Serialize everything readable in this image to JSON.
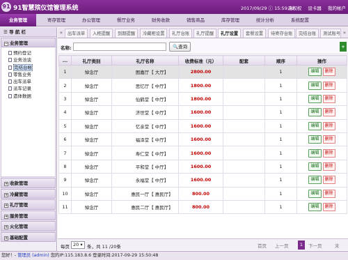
{
  "app": {
    "logo_text": "91",
    "title": "91智慧殡仪馆管理系统",
    "datetime": "2017/09/29 ⓘ 15:59:30",
    "top_links": [
      "高权权",
      "设卡器",
      "我的帐户"
    ]
  },
  "main_nav": [
    {
      "label": "业务管理",
      "active": true
    },
    {
      "label": "寄存管理",
      "active": false
    },
    {
      "label": "办公管理",
      "active": false
    },
    {
      "label": "餐厅业务",
      "active": false
    },
    {
      "label": "财务收款",
      "active": false
    },
    {
      "label": "销售商品",
      "active": false
    },
    {
      "label": "库存管理",
      "active": false
    },
    {
      "label": "统计分析",
      "active": false
    },
    {
      "label": "系统配置",
      "active": false
    }
  ],
  "sidebar": {
    "toolbar_label": "导 航 栏",
    "section_title": "业务管理",
    "items": [
      {
        "label": "预约登记",
        "selected": false
      },
      {
        "label": "业务洽谈",
        "selected": false
      },
      {
        "label": "完结台帐",
        "selected": true
      },
      {
        "label": "零售业务",
        "selected": false
      },
      {
        "label": "出车派单",
        "selected": false
      },
      {
        "label": "派车记录",
        "selected": false
      },
      {
        "label": "遗体数据",
        "selected": false
      }
    ],
    "collapsed_sections": [
      "收款管理",
      "冷藏管理",
      "礼厅管理",
      "服务管理",
      "火化管理",
      "基础配置"
    ]
  },
  "tabs": [
    {
      "label": "出车派单",
      "active": false
    },
    {
      "label": "入柜提醒",
      "active": false
    },
    {
      "label": "到期提醒",
      "active": false
    },
    {
      "label": "冷藏柜设置",
      "active": false
    },
    {
      "label": "礼厅台账",
      "active": false
    },
    {
      "label": "礼厅提醒",
      "active": false
    },
    {
      "label": "礼厅设置",
      "active": true
    },
    {
      "label": "套餐设置",
      "active": false
    },
    {
      "label": "待寄存台账",
      "active": false
    },
    {
      "label": "完结台账",
      "active": false
    },
    {
      "label": "测试账号一档案",
      "active": false
    }
  ],
  "search": {
    "label": "名称:",
    "value": "",
    "query_label": "查询",
    "add_label": "+"
  },
  "table": {
    "headers": [
      "...",
      "礼厅类别",
      "礼厅名称",
      "收费标准（元）",
      "配套",
      "顺序",
      "操作"
    ],
    "edit_label": "编辑",
    "delete_label": "删除",
    "rows": [
      {
        "no": "1",
        "category": "悼念厅",
        "name": "图嘉厅【 大厅】",
        "price": "2800.00",
        "kit": "",
        "order": "1",
        "selected": true
      },
      {
        "no": "2",
        "category": "悼念厅",
        "name": "思忆厅【 中厅】",
        "price": "1800.00",
        "kit": "",
        "order": "1",
        "selected": false
      },
      {
        "no": "3",
        "category": "悼念厅",
        "name": "仙鹤堂【 中厅】",
        "price": "1800.00",
        "kit": "",
        "order": "1",
        "selected": false
      },
      {
        "no": "4",
        "category": "悼念厅",
        "name": "济世堂【 中厅】",
        "price": "1600.00",
        "kit": "",
        "order": "1",
        "selected": false
      },
      {
        "no": "5",
        "category": "悼念厅",
        "name": "忆亲堂【 中厅】",
        "price": "1600.00",
        "kit": "",
        "order": "1",
        "selected": false
      },
      {
        "no": "6",
        "category": "悼念厅",
        "name": "福泽堂【 中厅】",
        "price": "1600.00",
        "kit": "",
        "order": "1",
        "selected": false
      },
      {
        "no": "7",
        "category": "悼念厅",
        "name": "寿仁堂【 中厅】",
        "price": "1600.00",
        "kit": "",
        "order": "1",
        "selected": false
      },
      {
        "no": "8",
        "category": "悼念厅",
        "name": "平和堂【 中厅】",
        "price": "1600.00",
        "kit": "",
        "order": "1",
        "selected": false
      },
      {
        "no": "9",
        "category": "悼念厅",
        "name": "永福堂【 中厅】",
        "price": "1600.00",
        "kit": "",
        "order": "1",
        "selected": false
      },
      {
        "no": "10",
        "category": "悼念厅",
        "name": "惠民一厅【 惠民厅】",
        "price": "800.00",
        "kit": "",
        "order": "1",
        "selected": false
      },
      {
        "no": "11",
        "category": "悼念厅",
        "name": "惠民二厅【 惠民厅】",
        "price": "800.00",
        "kit": "",
        "order": "1",
        "selected": false
      }
    ]
  },
  "pagination": {
    "per_page_label": "每页",
    "page_size": "20",
    "summary": "条，共 11 /20条",
    "first": "首页",
    "prev": "上一页",
    "current": "1",
    "next": "下一页",
    "last": "末"
  },
  "status_bar": {
    "user_prefix": "您好！-",
    "user": "管理员 (admin)",
    "ip_text": "您的IP:115.183.8.6",
    "login_text": "登录时间:2017-09-29 15:50:48"
  }
}
